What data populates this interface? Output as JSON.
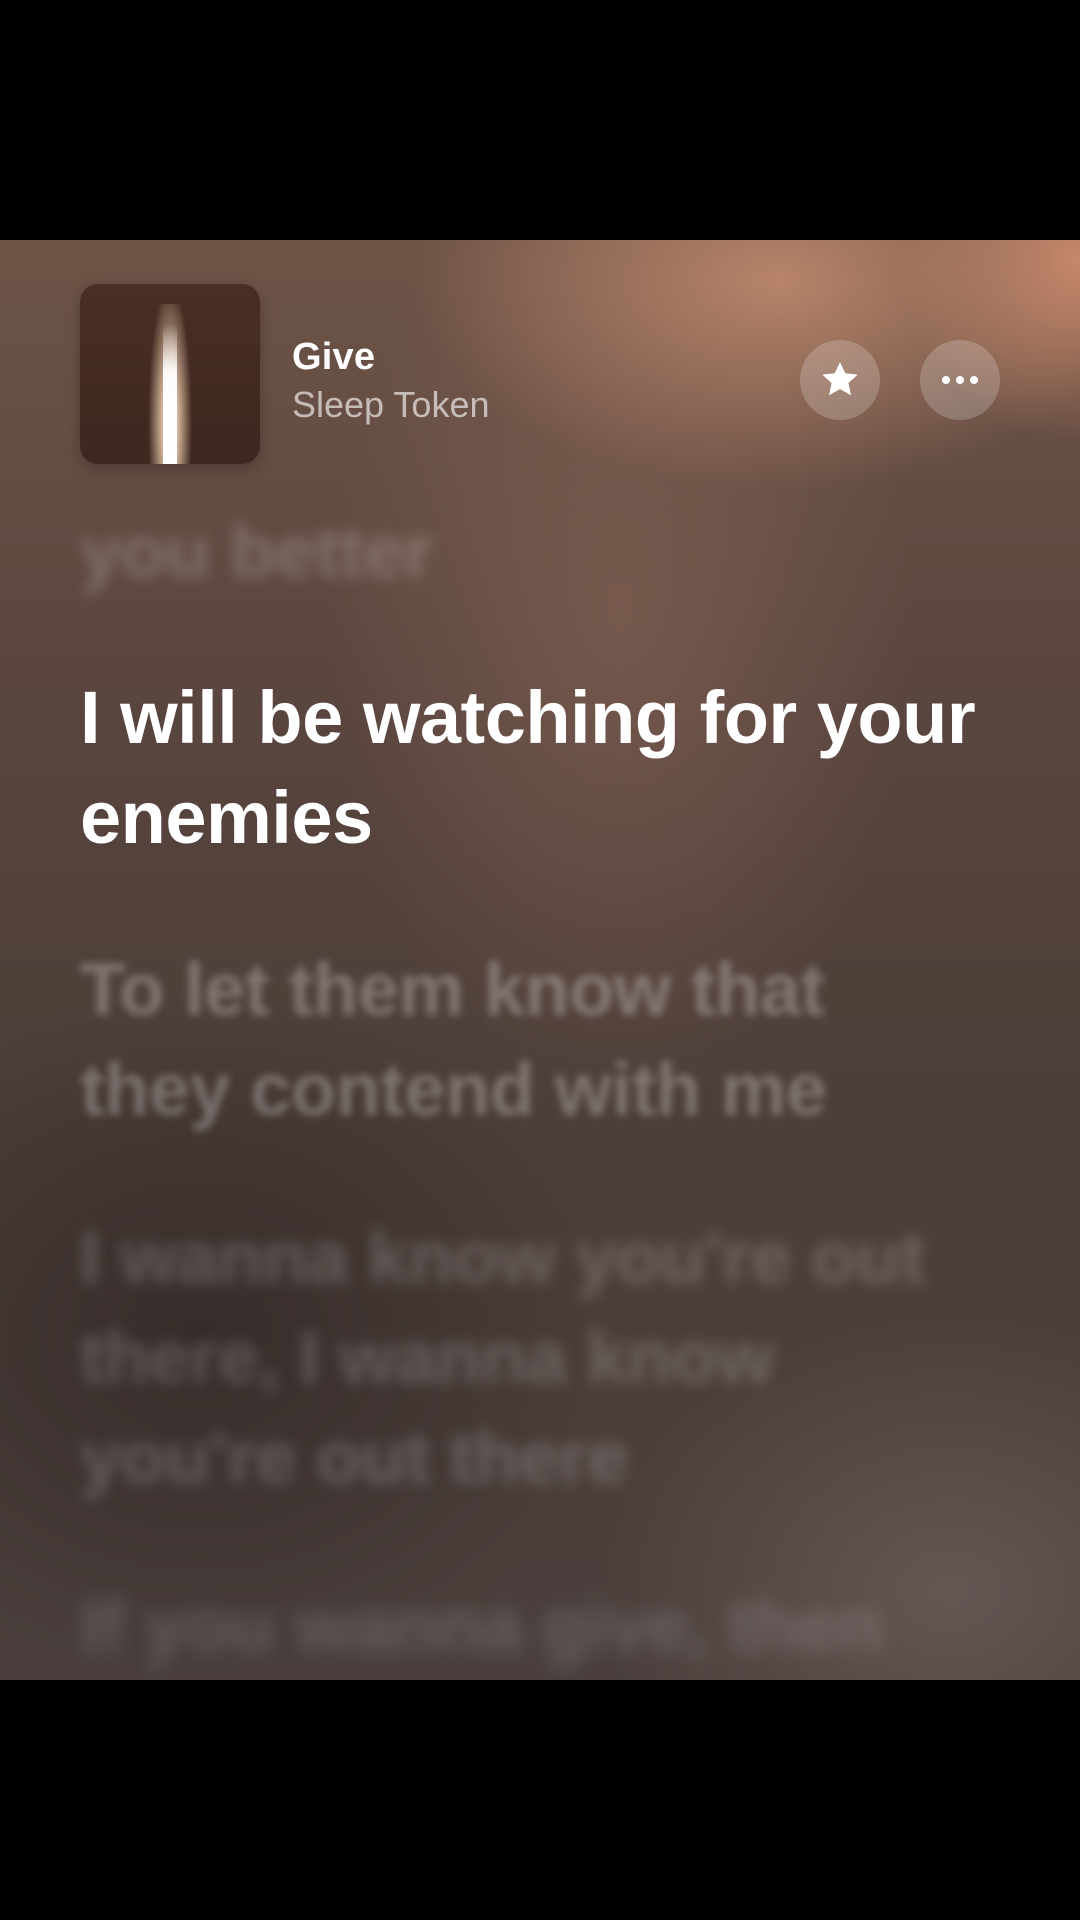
{
  "track": {
    "title": "Give",
    "artist": "Sleep Token"
  },
  "buttons": {
    "favorite_icon": "star-icon",
    "more_icon": "ellipsis-icon"
  },
  "lyrics": {
    "previous": "you better",
    "current": "I will be watching for your enemies",
    "upcoming": [
      "To let them know that they contend with me",
      "I wanna know you're out there, I wanna know you're out there",
      "If you wanna give, then"
    ]
  },
  "colors": {
    "active_lyric": "#ffffff",
    "background_top": "#6e5447",
    "background_bottom": "#4a3f3c"
  }
}
